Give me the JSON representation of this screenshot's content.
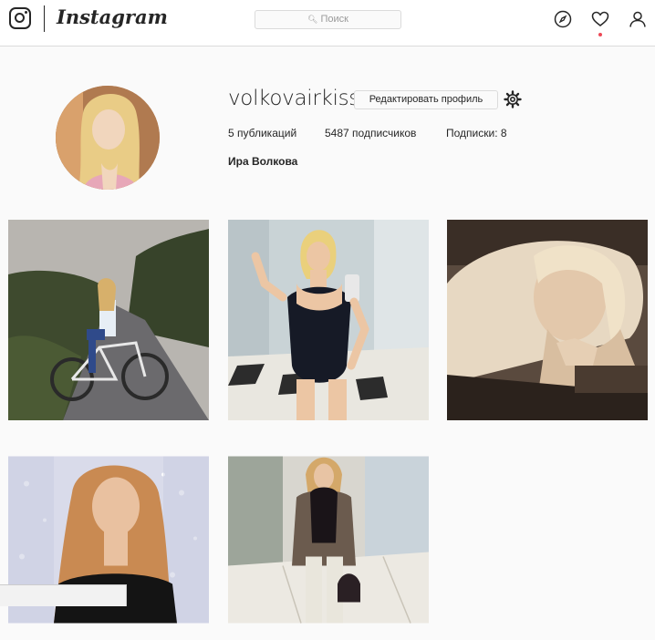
{
  "header": {
    "logo_text": "Instagram",
    "search": {
      "placeholder": "Поиск"
    },
    "icons": [
      "instagram-camera-icon",
      "explore-compass-icon",
      "activity-heart-icon",
      "profile-person-icon"
    ]
  },
  "profile": {
    "username": "volkovairkiss",
    "edit_label": "Редактировать профиль",
    "stats": {
      "posts": "5 публикаций",
      "followers": "5487 подписчиков",
      "following": "Подписки: 8"
    },
    "full_name": "Ира Волкова"
  },
  "colors": {
    "accent_dot": "#ed4956",
    "border": "#dbdbdb",
    "background": "#fafafa"
  },
  "posts": [
    {
      "description": "girl-with-bicycle-on-road"
    },
    {
      "description": "mirror-selfie-black-bodysuit"
    },
    {
      "description": "sepia-portrait-lying"
    },
    {
      "description": "portrait-with-lights"
    },
    {
      "description": "mall-full-length-photo"
    }
  ]
}
